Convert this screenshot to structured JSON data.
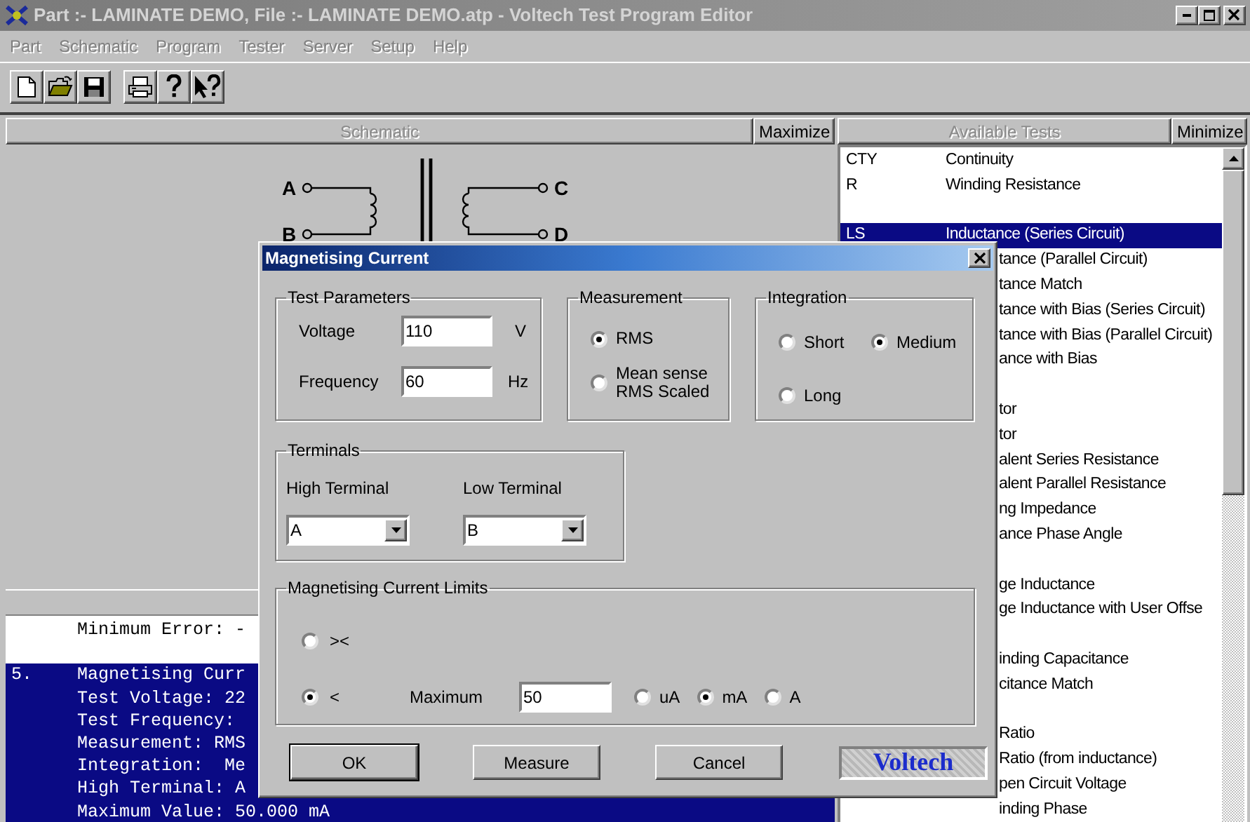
{
  "window": {
    "title": "Part :- LAMINATE DEMO, File :- LAMINATE DEMO.atp - Voltech Test Program Editor"
  },
  "menu": [
    {
      "label": "Part"
    },
    {
      "label": "Schematic"
    },
    {
      "label": "Program"
    },
    {
      "label": "Tester"
    },
    {
      "label": "Server"
    },
    {
      "label": "Setup"
    },
    {
      "label": "Help"
    }
  ],
  "toolbar": [
    {
      "kind": "new"
    },
    {
      "kind": "open"
    },
    {
      "kind": "save"
    },
    {
      "kind": "print"
    },
    {
      "kind": "help"
    },
    {
      "kind": "context-help"
    }
  ],
  "schematic_panel": {
    "header": "Schematic",
    "button": "Maximize",
    "terminals": [
      "A",
      "B",
      "C",
      "D"
    ]
  },
  "tests_panel": {
    "header": "Available Tests",
    "button": "Minimize",
    "rows": [
      {
        "kind": "test",
        "code": "CTY",
        "label": "Continuity",
        "selected": false
      },
      {
        "kind": "test",
        "code": "R",
        "label": "Winding Resistance",
        "selected": false
      },
      {
        "kind": "blank"
      },
      {
        "kind": "test",
        "code": "LS",
        "label": "Inductance (Series Circuit)",
        "selected": true
      },
      {
        "kind": "partial",
        "label": "tance (Parallel Circuit)"
      },
      {
        "kind": "partial",
        "label": "tance Match"
      },
      {
        "kind": "partial",
        "label": "tance with Bias (Series Circuit)"
      },
      {
        "kind": "partial",
        "label": "tance with Bias (Parallel Circuit)"
      },
      {
        "kind": "partial",
        "label": "ance with Bias"
      },
      {
        "kind": "blank"
      },
      {
        "kind": "partial",
        "label": "tor"
      },
      {
        "kind": "partial",
        "label": "tor"
      },
      {
        "kind": "partial",
        "label": "alent Series Resistance"
      },
      {
        "kind": "partial",
        "label": "alent Parallel Resistance"
      },
      {
        "kind": "partial",
        "label": "ng Impedance"
      },
      {
        "kind": "partial",
        "label": "ance Phase Angle"
      },
      {
        "kind": "blank"
      },
      {
        "kind": "partial",
        "label": "ge Inductance"
      },
      {
        "kind": "partial",
        "label": "ge Inductance with User Offse"
      },
      {
        "kind": "blank"
      },
      {
        "kind": "partial",
        "label": "inding Capacitance"
      },
      {
        "kind": "partial",
        "label": "citance Match"
      },
      {
        "kind": "blank"
      },
      {
        "kind": "partial",
        "label": "Ratio"
      },
      {
        "kind": "partial",
        "label": "Ratio (from inductance)"
      },
      {
        "kind": "partial",
        "label": "pen Circuit Voltage"
      },
      {
        "kind": "partial",
        "label": "inding Phase"
      }
    ]
  },
  "program_listing": {
    "rows": [
      {
        "text": "Minimum Error: -",
        "selected": false
      },
      {
        "text": "",
        "selected": false
      },
      {
        "number": "5.",
        "text": "Magnetising Curr",
        "selected": true
      },
      {
        "text": "Test Voltage: 22",
        "selected": true
      },
      {
        "text": "Test Frequency:",
        "selected": true
      },
      {
        "text": "Measurement: RMS",
        "selected": true
      },
      {
        "text": "Integration:  Me",
        "selected": true
      },
      {
        "text": "High Terminal: A",
        "selected": true
      },
      {
        "text": "Maximum Value: 50.000 mA",
        "selected": true
      }
    ]
  },
  "dialog": {
    "title": "Magnetising Current",
    "test_parameters": {
      "label": "Test Parameters",
      "fields": [
        {
          "label": "Voltage",
          "value": "110",
          "unit": "V"
        },
        {
          "label": "Frequency",
          "value": "60",
          "unit": "Hz"
        }
      ]
    },
    "measurement": {
      "label": "Measurement",
      "options": [
        {
          "label": "RMS",
          "selected": true
        },
        {
          "label": "Mean sense RMS Scaled",
          "selected": false
        }
      ]
    },
    "integration": {
      "label": "Integration",
      "options": [
        {
          "label": "Short",
          "selected": false
        },
        {
          "label": "Medium",
          "selected": true
        },
        {
          "label": "Long",
          "selected": false
        }
      ]
    },
    "terminals": {
      "label": "Terminals",
      "fields": [
        {
          "label": "High Terminal",
          "value": "A"
        },
        {
          "label": "Low Terminal",
          "value": "B"
        }
      ]
    },
    "limits": {
      "label": "Magnetising Current Limits",
      "modes": [
        {
          "label": "><",
          "selected": false
        },
        {
          "label": "<",
          "selected": true
        }
      ],
      "maximum": {
        "label": "Maximum",
        "value": "50"
      },
      "units": [
        {
          "label": "uA",
          "selected": false
        },
        {
          "label": "mA",
          "selected": true
        },
        {
          "label": "A",
          "selected": false
        }
      ]
    },
    "buttons": [
      {
        "label": "OK",
        "default": true
      },
      {
        "label": "Measure",
        "default": false
      },
      {
        "label": "Cancel",
        "default": false
      }
    ],
    "logo": "Voltech"
  }
}
